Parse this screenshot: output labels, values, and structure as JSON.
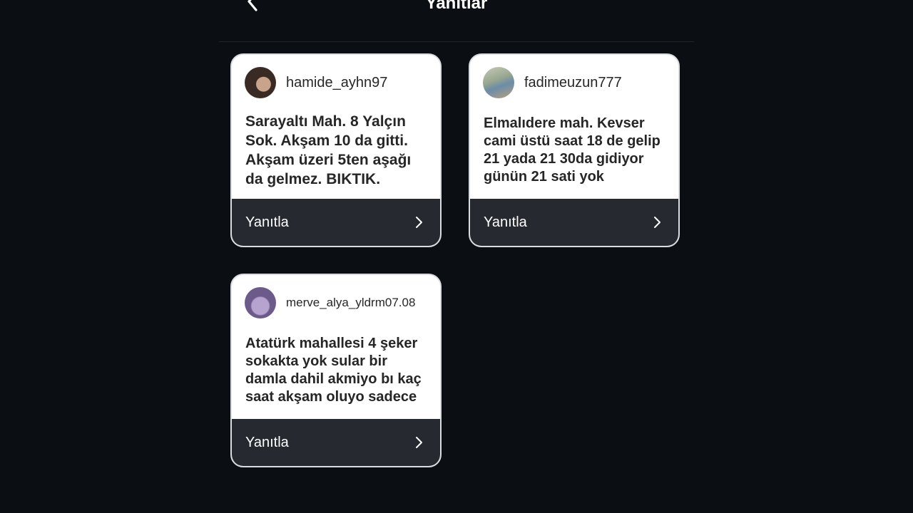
{
  "header": {
    "title": "Yanıtlar",
    "back_icon": "chevron-left-icon"
  },
  "replies": [
    {
      "username": "hamide_ayhn97",
      "text": "Sarayaltı Mah. 8 Yalçın Sok. Akşam 10 da gitti. Akşam üzeri 5ten aşağı da gelmez. BIKTIK.",
      "action_label": "Yanıtla"
    },
    {
      "username": "fadimeuzun777",
      "text": "Elmalıdere mah. Kevser cami üstü saat 18 de gelip 21 yada 21 30da gidiyor günün 21 sati yok",
      "action_label": "Yanıtla"
    },
    {
      "username": "merve_alya_yldrm07.08",
      "text": "Atatürk mahallesi 4 şeker sokakta yok sular bir damla dahil akmiyo bı kaç saat akşam oluyo sadece",
      "action_label": "Yanıtla"
    }
  ],
  "colors": {
    "background": "#0b0f14",
    "card": "#ffffff",
    "reply_bar": "#262a30",
    "text": "#262626"
  }
}
